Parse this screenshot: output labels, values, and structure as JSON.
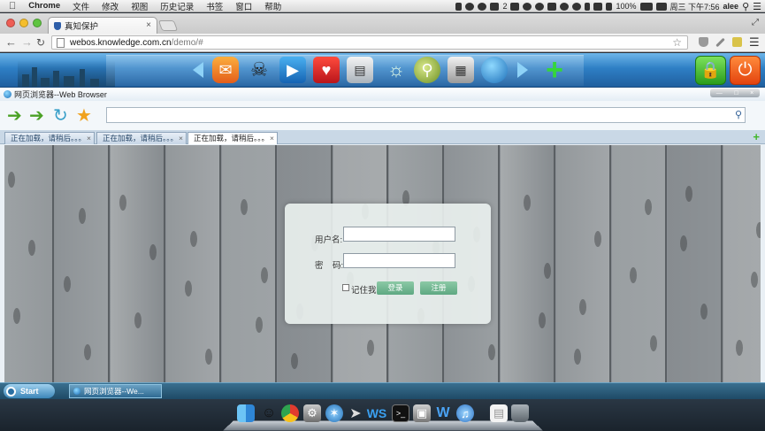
{
  "menubar": {
    "app_name": "Chrome",
    "items": [
      "文件",
      "修改",
      "视图",
      "历史记录",
      "书签",
      "窗口",
      "帮助"
    ],
    "battery": "100%",
    "clock": "周三 下午7:56",
    "user": "alee",
    "badge": "2"
  },
  "chrome": {
    "tab_title": "真知保护",
    "url_host": "webos.knowledge.com.cn",
    "url_path": "/demo/#"
  },
  "webos": {
    "apps": [
      "chat-icon",
      "gamepad-icon",
      "video-icon",
      "photo-icon",
      "news-icon",
      "bulb-icon",
      "search-icon",
      "cards-icon",
      "globe-icon",
      "add-icon"
    ],
    "lock_icon": "lock-icon",
    "power_icon": "power-icon"
  },
  "window": {
    "title": "网页浏览器--Web Browser",
    "address": "",
    "tabs": [
      {
        "label": "正在加载，请稍后。。。"
      },
      {
        "label": "正在加载，请稍后。。。"
      },
      {
        "label": "正在加载，请稍后。。。"
      }
    ]
  },
  "login": {
    "user_label": "用户名:",
    "password_label": "密    码:",
    "user_value": "",
    "password_value": "",
    "remember_label": "记住我",
    "login_button": "登录",
    "register_button": "注册"
  },
  "taskbar": {
    "start_label": "Start",
    "task_label": "网页浏览器--We..."
  }
}
